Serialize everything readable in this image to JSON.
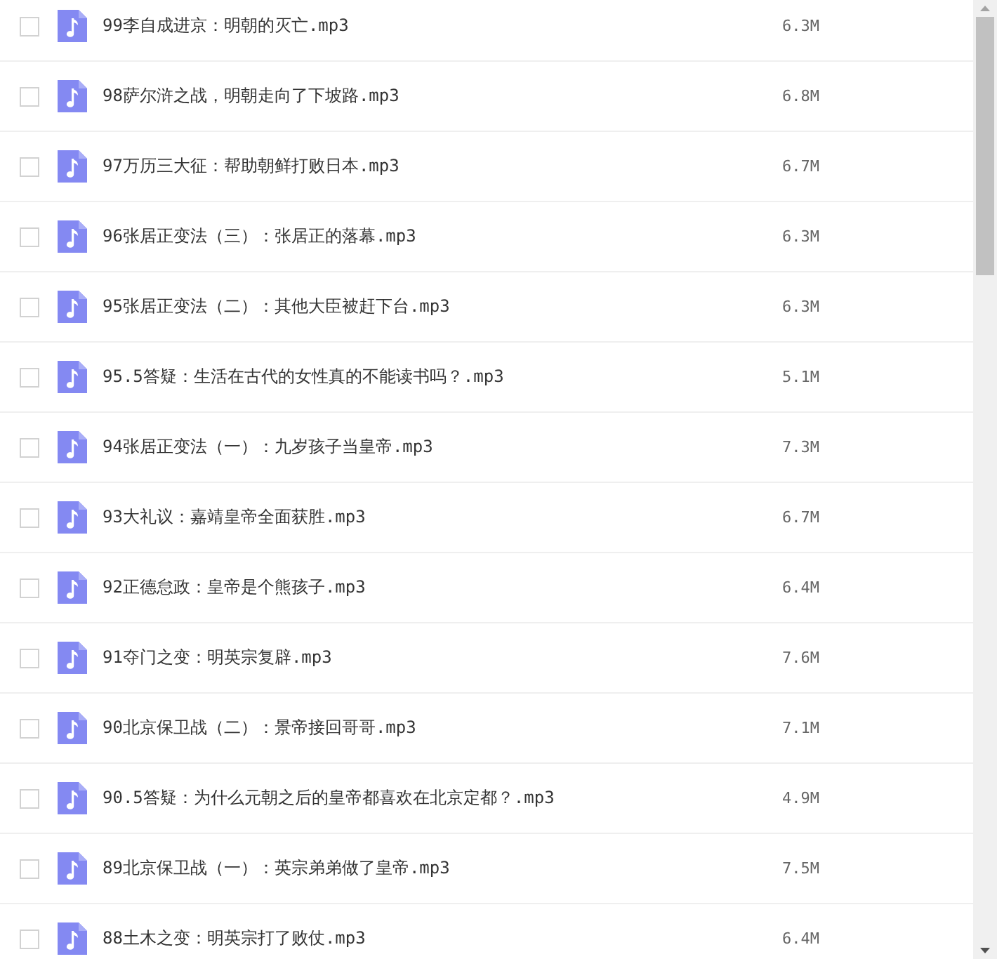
{
  "files": [
    {
      "name": "99李自成进京：明朝的灭亡.mp3",
      "size": "6.3M",
      "checked": false
    },
    {
      "name": "98萨尔浒之战，明朝走向了下坡路.mp3",
      "size": "6.8M",
      "checked": false
    },
    {
      "name": "97万历三大征：帮助朝鲜打败日本.mp3",
      "size": "6.7M",
      "checked": false
    },
    {
      "name": "96张居正变法（三）：张居正的落幕.mp3",
      "size": "6.3M",
      "checked": false
    },
    {
      "name": "95张居正变法（二）：其他大臣被赶下台.mp3",
      "size": "6.3M",
      "checked": false
    },
    {
      "name": "95.5答疑：生活在古代的女性真的不能读书吗？.mp3",
      "size": "5.1M",
      "checked": false
    },
    {
      "name": "94张居正变法（一）：九岁孩子当皇帝.mp3",
      "size": "7.3M",
      "checked": false
    },
    {
      "name": "93大礼议：嘉靖皇帝全面获胜.mp3",
      "size": "6.7M",
      "checked": false
    },
    {
      "name": "92正德怠政：皇帝是个熊孩子.mp3",
      "size": "6.4M",
      "checked": false
    },
    {
      "name": "91夺门之变：明英宗复辟.mp3",
      "size": "7.6M",
      "checked": false
    },
    {
      "name": "90北京保卫战（二）：景帝接回哥哥.mp3",
      "size": "7.1M",
      "checked": false
    },
    {
      "name": "90.5答疑：为什么元朝之后的皇帝都喜欢在北京定都？.mp3",
      "size": "4.9M",
      "checked": false
    },
    {
      "name": "89北京保卫战（一）：英宗弟弟做了皇帝.mp3",
      "size": "7.5M",
      "checked": false
    },
    {
      "name": "88土木之变：明英宗打了败仗.mp3",
      "size": "6.4M",
      "checked": false
    }
  ]
}
